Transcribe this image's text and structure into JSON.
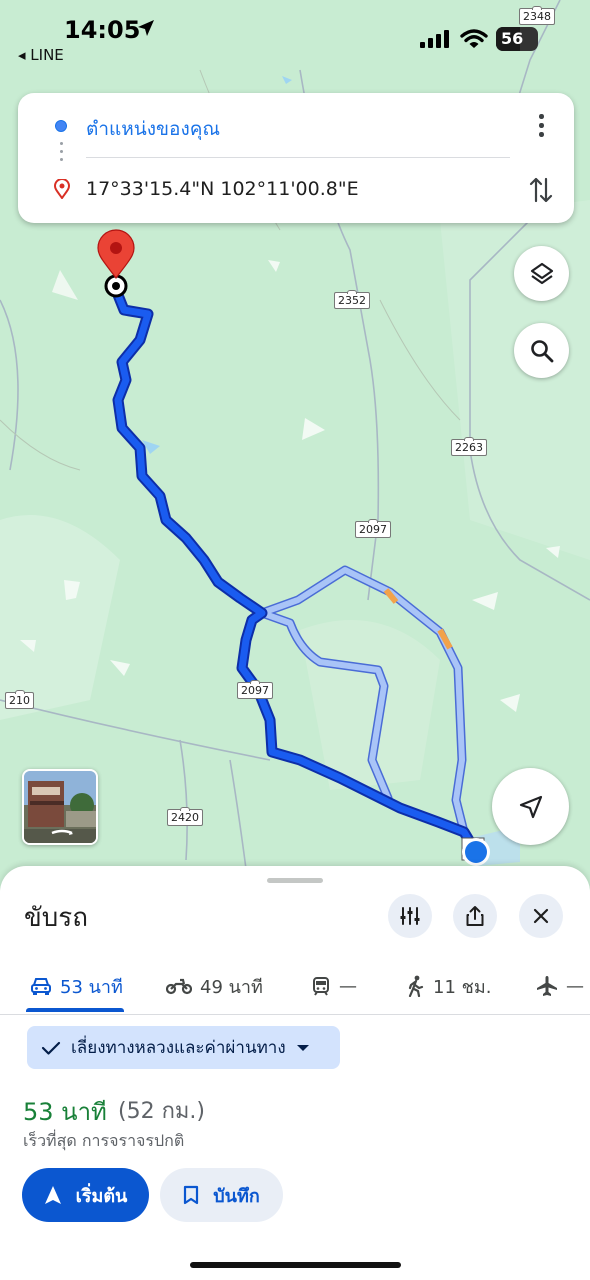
{
  "status_bar": {
    "time": "14:05",
    "back_app": "◂ LINE",
    "battery": "56"
  },
  "route_card": {
    "origin": "ตำแหน่งของคุณ",
    "destination": "17°33'15.4\"N 102°11'00.8\"E"
  },
  "map": {
    "road_labels": [
      "2348",
      "2352",
      "2263",
      "2097",
      "2097",
      "210",
      "2420"
    ],
    "colors": {
      "land": "#c8ecd2",
      "route_primary": "#1a5cf0",
      "route_alternate": "#a9c4f7",
      "origin_dot": "#4285f4",
      "destination_pin": "#ea4335"
    }
  },
  "sheet": {
    "title": "ขับรถ",
    "modes": [
      {
        "icon": "car-icon",
        "value": "53 นาที",
        "active": true
      },
      {
        "icon": "motorcycle-icon",
        "value": "49 นาที",
        "active": false
      },
      {
        "icon": "transit-icon",
        "value": "—",
        "active": false
      },
      {
        "icon": "walk-icon",
        "value": "11 ชม.",
        "active": false
      },
      {
        "icon": "flight-icon",
        "value": "—",
        "active": false
      }
    ],
    "avoid_chip": "เลี่ยงทางหลวงและค่าผ่านทาง",
    "duration": "53 นาที",
    "distance": "(52 กม.)",
    "subtitle": "เร็วที่สุด การจราจรปกติ",
    "start_label": "เริ่มต้น",
    "save_label": "บันทึก"
  }
}
